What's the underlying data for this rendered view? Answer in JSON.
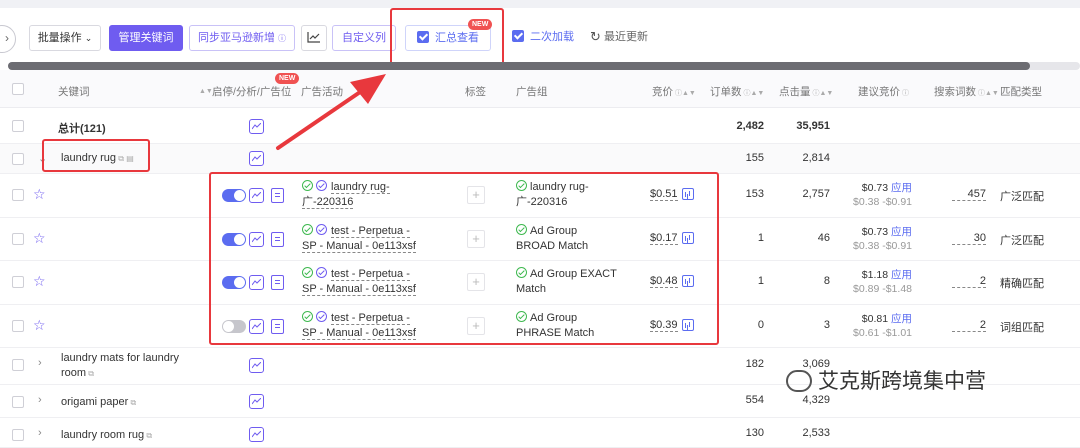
{
  "toolbar": {
    "bulk_label": "批量操作",
    "manage_label": "管理关键词",
    "sync_label": "同步亚马逊新增",
    "custom_cols_label": "自定义列",
    "summary_label": "汇总查看",
    "secondary_label": "二次加载",
    "recent_label": "最近更新",
    "new_badge": "NEW"
  },
  "header": {
    "keyword": "关键词",
    "enable": "启停/分析/广告位",
    "campaign": "广告活动",
    "tag": "标签",
    "adgroup": "广告组",
    "bid": "竞价",
    "orders": "订单数",
    "clicks": "点击量",
    "suggested": "建议竞价",
    "search_count": "搜索词数",
    "match_type": "匹配类型",
    "new_badge": "NEW"
  },
  "total": {
    "label": "总计(121)",
    "orders": "2,482",
    "clicks": "35,951"
  },
  "group": {
    "keyword": "laundry rug",
    "orders": "155",
    "clicks": "2,814"
  },
  "details": [
    {
      "toggle_on": true,
      "campaign_l1": "laundry rug-",
      "campaign_l2": "广-220316",
      "adgroup_l1": "laundry rug-",
      "adgroup_l2": "广-220316",
      "bid": "$0.51",
      "orders": "153",
      "clicks": "2,757",
      "sugg": "$0.73",
      "apply": "应用",
      "range": "$0.38 -$0.91",
      "search": "457",
      "match": "广泛匹配"
    },
    {
      "toggle_on": true,
      "campaign_l1": "test - Perpetua -",
      "campaign_l2": "SP - Manual - 0e113xsf",
      "adgroup_l1": "Ad Group",
      "adgroup_l2": "BROAD Match",
      "bid": "$0.17",
      "orders": "1",
      "clicks": "46",
      "sugg": "$0.73",
      "apply": "应用",
      "range": "$0.38 -$0.91",
      "search": "30",
      "match": "广泛匹配"
    },
    {
      "toggle_on": true,
      "campaign_l1": "test - Perpetua -",
      "campaign_l2": "SP - Manual - 0e113xsf",
      "adgroup_l1": "Ad Group EXACT",
      "adgroup_l2": "Match",
      "bid": "$0.48",
      "orders": "1",
      "clicks": "8",
      "sugg": "$1.18",
      "apply": "应用",
      "range": "$0.89 -$1.48",
      "search": "2",
      "match": "精确匹配"
    },
    {
      "toggle_on": false,
      "campaign_l1": "test - Perpetua -",
      "campaign_l2": "SP - Manual - 0e113xsf",
      "adgroup_l1": "Ad Group",
      "adgroup_l2": "PHRASE Match",
      "bid": "$0.39",
      "orders": "0",
      "clicks": "3",
      "sugg": "$0.81",
      "apply": "应用",
      "range": "$0.61 -$1.01",
      "search": "2",
      "match": "词组匹配"
    }
  ],
  "others": [
    {
      "l1": "laundry mats for laundry",
      "l2": "room",
      "orders": "182",
      "clicks": "3,069"
    },
    {
      "l1": "origami paper",
      "l2": "",
      "orders": "554",
      "clicks": "4,329"
    },
    {
      "l1": "laundry room rug",
      "l2": "",
      "orders": "130",
      "clicks": "2,533"
    }
  ],
  "watermark": "艾克斯跨境集中营"
}
